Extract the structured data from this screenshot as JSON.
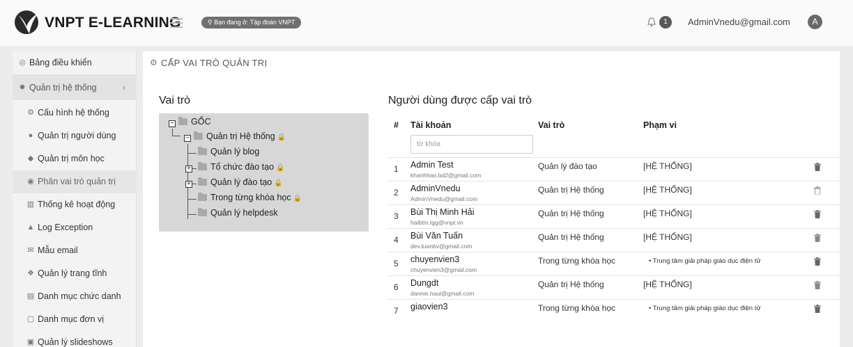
{
  "header": {
    "brand": "VNPT E-LEARNING",
    "location": "Bạn đang ở: Tập đoàn VNPT",
    "notification_count": "1",
    "user_email": "AdminVnedu@gmail.com",
    "avatar_initial": "A",
    "icons": [
      "vnpt-logo-icon",
      "hamburger-menu-icon",
      "location-pin-icon",
      "bell-icon",
      "user-avatar-icon"
    ]
  },
  "sidebar": {
    "items": [
      {
        "label": "Bảng điều khiển",
        "icon": "dashboard-icon"
      },
      {
        "label": "Quản trị hệ thống",
        "icon": "settings-icon",
        "chevron": "‹"
      },
      {
        "label": "Cấu hình hệ thống",
        "icon": "gears-icon"
      },
      {
        "label": "Quản trị người dùng",
        "icon": "user-icon"
      },
      {
        "label": "Quản trị môn học",
        "icon": "tag-icon"
      },
      {
        "label": "Phân vai trò quản trị",
        "icon": "role-icon"
      },
      {
        "label": "Thống kê hoạt động",
        "icon": "bar-chart-icon"
      },
      {
        "label": "Log Exception",
        "icon": "warning-icon"
      },
      {
        "label": "Mẫu email",
        "icon": "mail-icon"
      },
      {
        "label": "Quản lý trang tĩnh",
        "icon": "pages-icon"
      },
      {
        "label": "Danh mục chức danh",
        "icon": "list-icon"
      },
      {
        "label": "Danh mục đơn vị",
        "icon": "unit-icon"
      },
      {
        "label": "Quản lý slideshows",
        "icon": "slideshow-icon"
      }
    ]
  },
  "page": {
    "title": "CẤP VAI TRÒ QUẢN TRỊ",
    "roles_title": "Vai trò",
    "users_title": "Người dùng được cấp vai trò"
  },
  "tree": {
    "root": "GỐC",
    "nodes": [
      {
        "label": "Quản trị Hệ thống",
        "locked": true
      },
      {
        "label": "Quản lý blog",
        "locked": false
      },
      {
        "label": "Tổ chức đào tạo",
        "locked": true
      },
      {
        "label": "Quản lý đào tạo",
        "locked": true
      },
      {
        "label": "Trong từng khóa học",
        "locked": true
      },
      {
        "label": "Quản lý helpdesk",
        "locked": false
      }
    ]
  },
  "table": {
    "headers": {
      "num": "#",
      "account": "Tài khoản",
      "role": "Vai trò",
      "scope": "Phạm vi"
    },
    "search_placeholder": "từ khóa",
    "rows": [
      {
        "num": "1",
        "name": "Admin Test",
        "email": "khanhhao.bd2@gmail.com",
        "role": "Quản lý đào tạo",
        "scope": "[HỆ THỐNG]"
      },
      {
        "num": "2",
        "name": "AdminVnedu",
        "email": "AdminVnedu@gmail.com",
        "role": "Quản trị Hệ thống",
        "scope": "[HỆ THỐNG]"
      },
      {
        "num": "3",
        "name": "Bùi Thị Minh Hải",
        "email": "haibtm.tgg@vnpt.vn",
        "role": "Quản trị Hệ thống",
        "scope": "[HỆ THỐNG]"
      },
      {
        "num": "4",
        "name": "Bùi Văn Tuấn",
        "email": "dev.tuanbv@gmail.com",
        "role": "Quản trị Hệ thống",
        "scope": "[HỆ THỐNG]"
      },
      {
        "num": "5",
        "name": "chuyenvien3",
        "email": "chuyenvien3@gmail.com",
        "role": "Trong từng khóa học",
        "scope": "• Trung tâm giải pháp giáo dục điện tử"
      },
      {
        "num": "6",
        "name": "Dungdt",
        "email": "dannie.haul@gmail.com",
        "role": "Quản trị Hệ thống",
        "scope": "[HỆ THỐNG]"
      },
      {
        "num": "7",
        "name": "giaovien3",
        "email": "",
        "role": "Trong từng khóa học",
        "scope": "• Trung tâm giải pháp giáo dục điện tử"
      }
    ]
  }
}
